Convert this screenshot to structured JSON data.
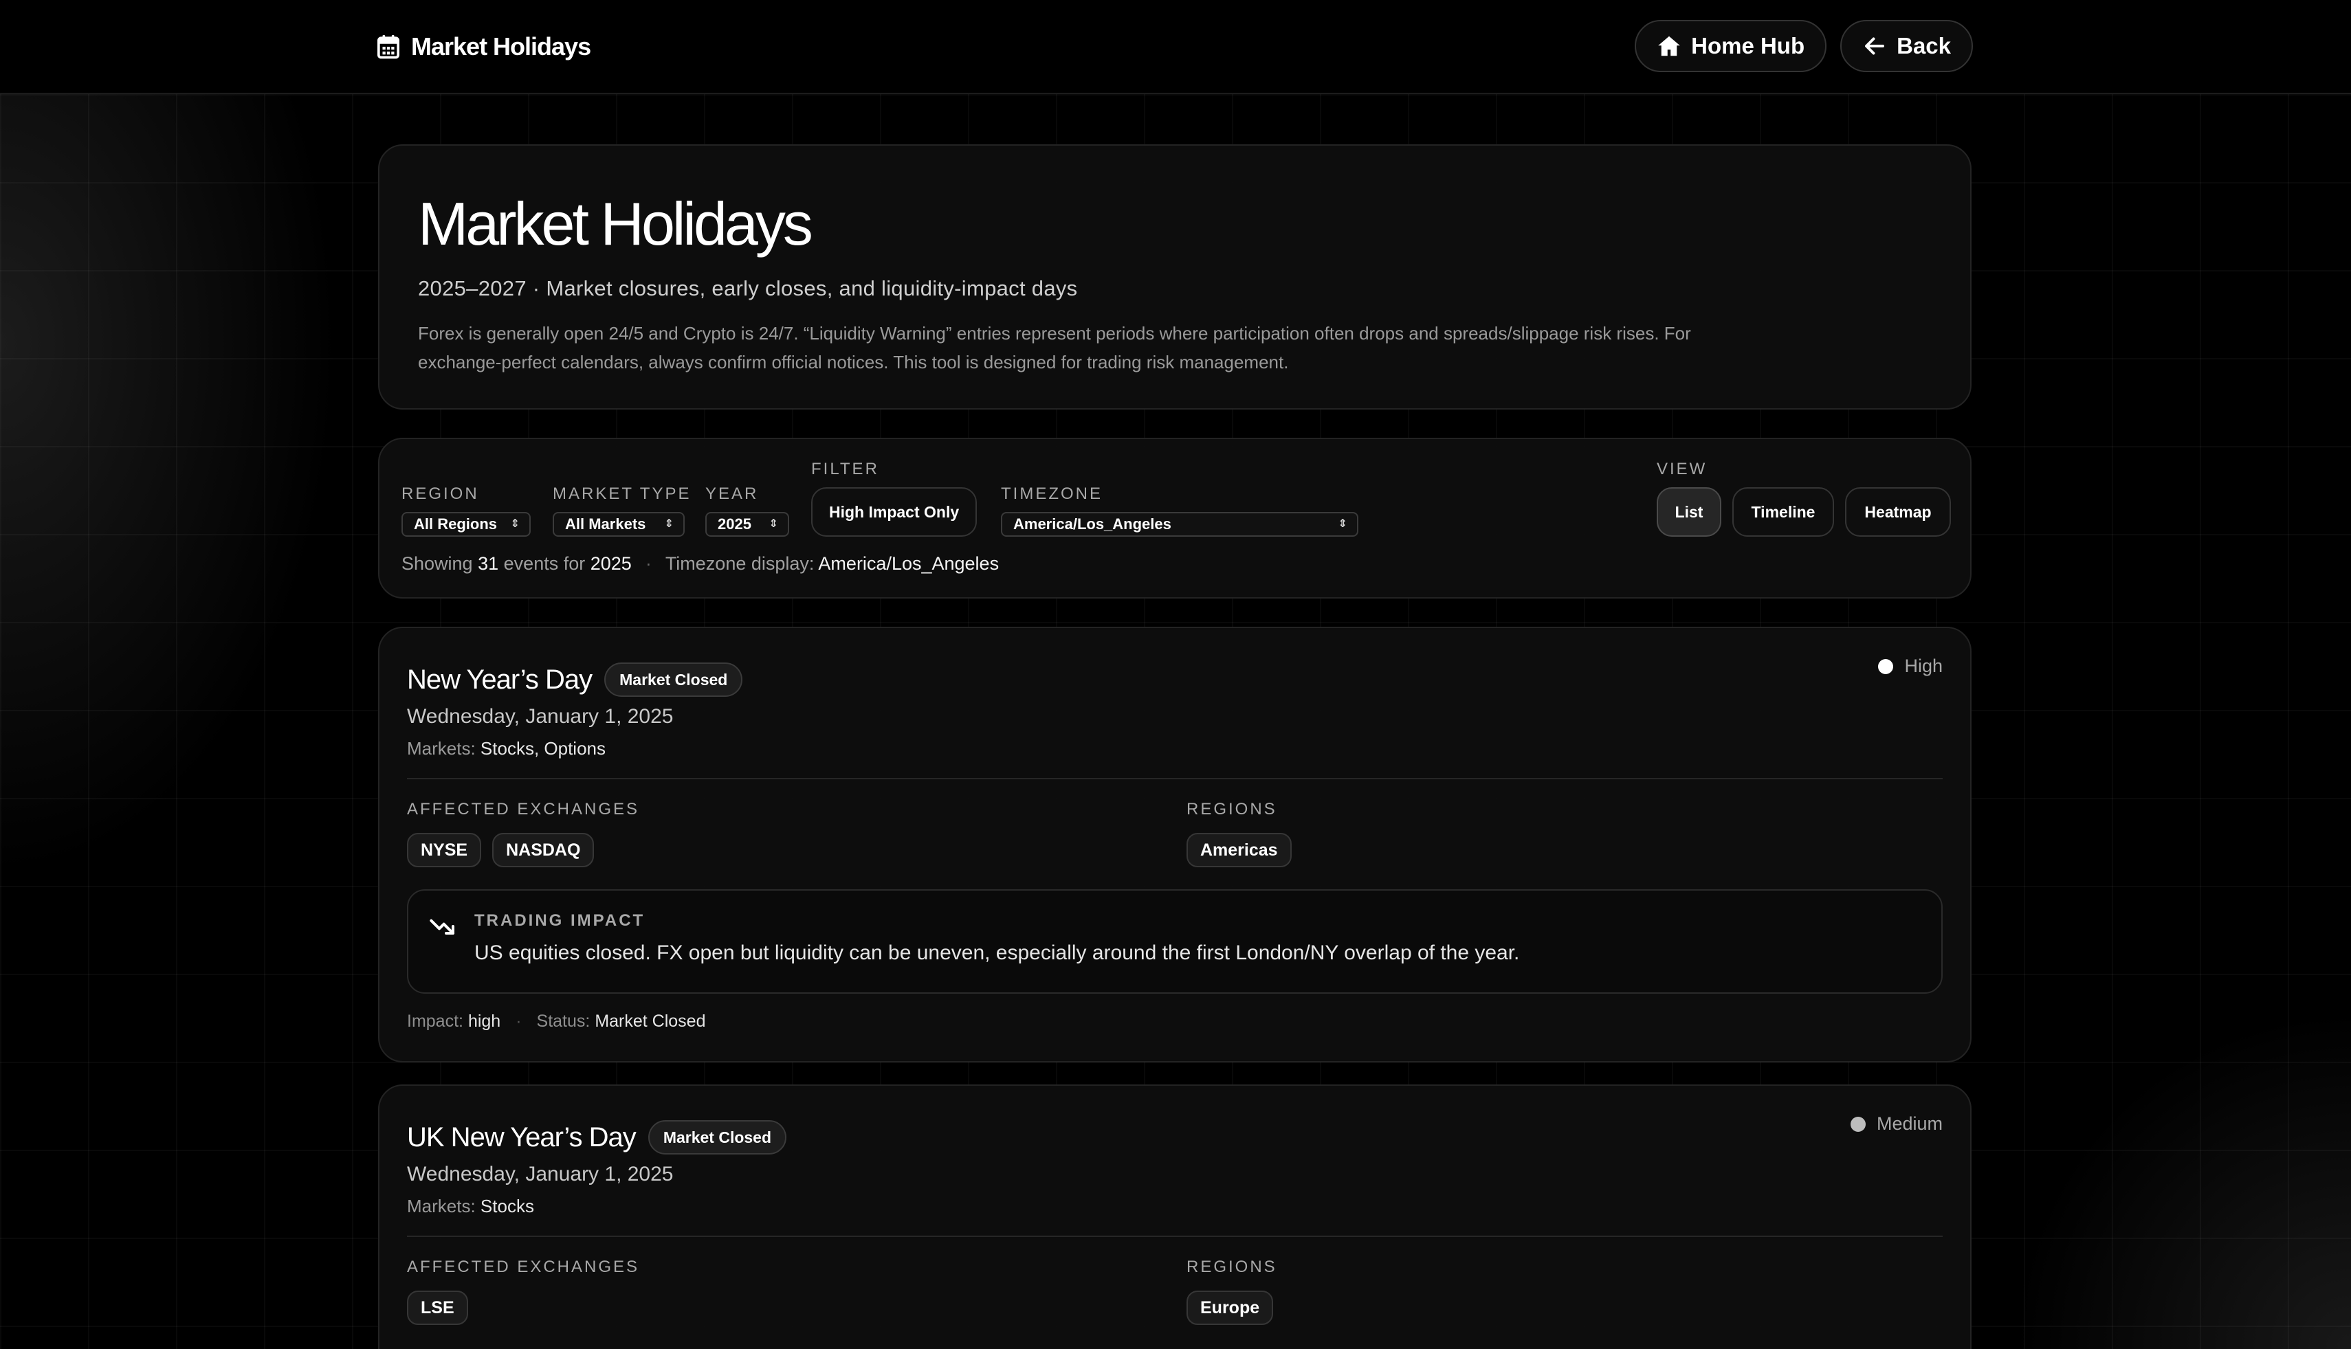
{
  "header": {
    "title": "Market Holidays",
    "icon": "calendar-icon",
    "home_label": "Home Hub",
    "back_label": "Back"
  },
  "hero": {
    "title": "Market Holidays",
    "subtitle": "2025–2027 · Market closures, early closes, and liquidity-impact days",
    "description": "Forex is generally open 24/5 and Crypto is 24/7. “Liquidity Warning” entries represent periods where participation often drops and spreads/slippage risk rises. For exchange-perfect calendars, always confirm official notices. This tool is designed for trading risk management."
  },
  "filters": {
    "region": {
      "label": "Region",
      "value": "All Regions"
    },
    "market_type": {
      "label": "Market Type",
      "value": "All Markets"
    },
    "year": {
      "label": "Year",
      "value": "2025"
    },
    "filter": {
      "label": "Filter",
      "button": "High Impact Only"
    },
    "timezone": {
      "label": "Timezone",
      "value": "America/Los_Angeles"
    },
    "view": {
      "label": "View",
      "options": [
        "List",
        "Timeline",
        "Heatmap"
      ],
      "active": "List"
    },
    "summary": {
      "showing": "Showing",
      "count": "31",
      "events_for": "events for",
      "year": "2025",
      "tz_label": "Timezone display:",
      "tz_value": "America/Los_Angeles"
    }
  },
  "events": [
    {
      "title": "New Year’s Day",
      "status_badge": "Market Closed",
      "impact_label": "High",
      "date": "Wednesday, January 1, 2025",
      "markets_label": "Markets:",
      "markets": "Stocks, Options",
      "exchanges_label": "Affected Exchanges",
      "exchanges": [
        "NYSE",
        "NASDAQ"
      ],
      "regions_label": "Regions",
      "regions": [
        "Americas"
      ],
      "trading_impact_label": "Trading Impact",
      "trading_impact": "US equities closed. FX open but liquidity can be uneven, especially around the first London/NY overlap of the year.",
      "footer": {
        "impact_label": "Impact:",
        "impact": "high",
        "status_label": "Status:",
        "status": "Market Closed"
      }
    },
    {
      "title": "UK New Year’s Day",
      "status_badge": "Market Closed",
      "impact_label": "Medium",
      "date": "Wednesday, January 1, 2025",
      "markets_label": "Markets:",
      "markets": "Stocks",
      "exchanges_label": "Affected Exchanges",
      "exchanges": [
        "LSE"
      ],
      "regions_label": "Regions",
      "regions": [
        "Europe"
      ]
    }
  ]
}
